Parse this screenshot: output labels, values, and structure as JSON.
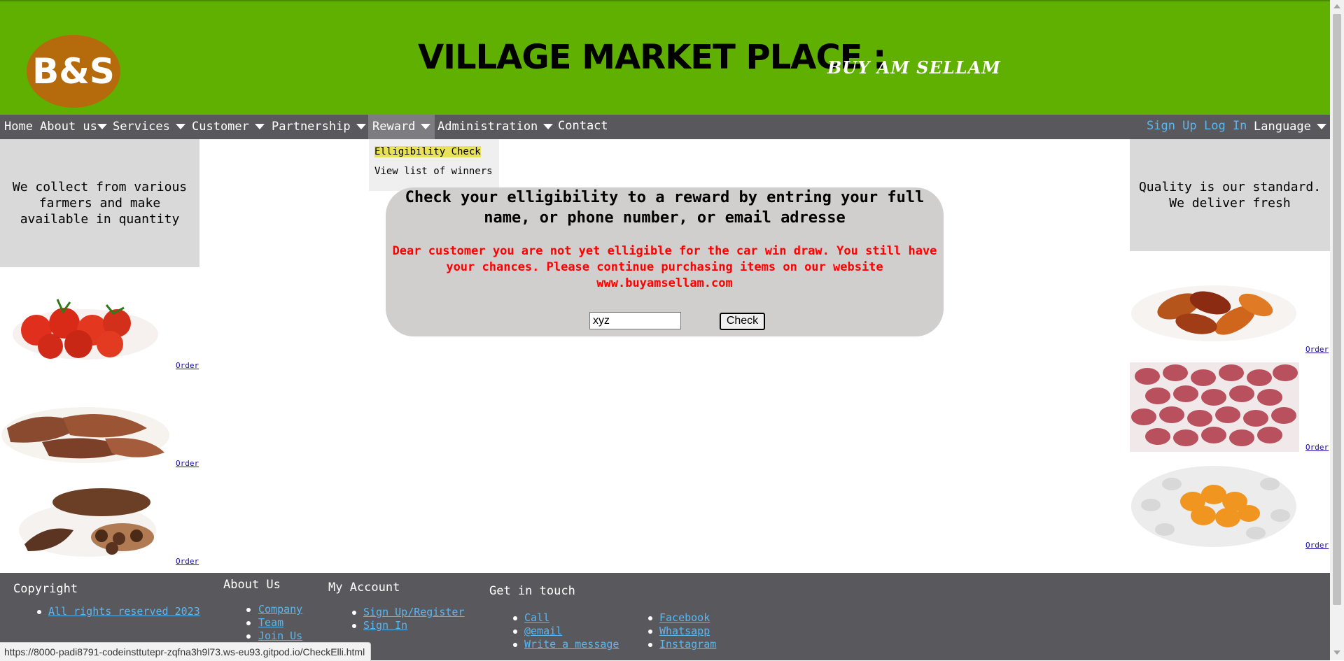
{
  "header": {
    "logo": "B&S",
    "title": "VILLAGE MARKET PLACE :",
    "subtitle": "BUY AM SELLAM"
  },
  "nav": {
    "items": [
      {
        "label": "Home"
      },
      {
        "label": "About us"
      },
      {
        "label": "Services"
      },
      {
        "label": "Customer"
      },
      {
        "label": "Partnership"
      },
      {
        "label": "Reward"
      },
      {
        "label": "Administration"
      },
      {
        "label": "Contact"
      }
    ],
    "sign_up": "Sign Up",
    "log_in": "Log In",
    "language": "Language"
  },
  "dropdown": {
    "items": [
      "Elligibility Check",
      "View list of winners"
    ]
  },
  "left_panel": {
    "text": "We collect from various farmers and make available in quantity",
    "products": [
      {
        "icon": "tomatoes-image",
        "order": "Order"
      },
      {
        "icon": "yam-image",
        "order": "Order"
      },
      {
        "icon": "cocoa-image",
        "order": "Order"
      }
    ]
  },
  "right_panel": {
    "text": "Quality is our standard. We deliver fresh",
    "products": [
      {
        "icon": "palm-nuts-image",
        "order": "Order"
      },
      {
        "icon": "kola-nuts-image",
        "order": "Order"
      },
      {
        "icon": "peppers-image",
        "order": "Order"
      }
    ]
  },
  "main": {
    "title": "Check your elligibility to a reward by entring your full name, or phone number, or email adresse",
    "message": "Dear customer you are not yet elligible for the car win draw. You still have your chances. Please continue purchasing items on our website www.buyamsellam.com",
    "input_value": "xyz",
    "check_label": "Check"
  },
  "footer": {
    "copyright_head": "Copyright",
    "copyright_link": "All rights reserved 2023",
    "about_head": "About Us",
    "about_links": [
      "Company",
      "Team",
      "Join Us"
    ],
    "account_head": "My Account",
    "account_links": [
      "Sign Up/Register",
      "Sign In"
    ],
    "touch_head": "Get in touch",
    "touch_links": [
      "Call",
      "@email",
      "Write a message"
    ],
    "social_links": [
      "Facebook",
      "Whatsapp",
      "Instagram"
    ]
  },
  "status_url": "https://8000-padi8791-codeinsttutepr-zqfna3h9l73.ws-eu93.gitpod.io/CheckElli.html",
  "colors": {
    "header": "#5fb000",
    "nav": "#59585d",
    "logo": "#b56a0c",
    "link": "#5ab7ef",
    "error": "#ff0000",
    "highlight": "#e8e25a"
  }
}
